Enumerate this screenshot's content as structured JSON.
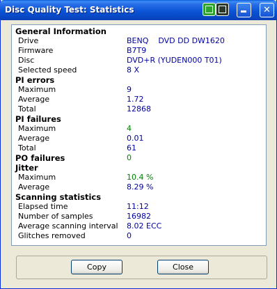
{
  "window": {
    "title": "Disc Quality Test: Statistics"
  },
  "titlebar_icons": [
    "chart-icon",
    "monitor-icon"
  ],
  "general": {
    "heading": "General Information",
    "drive_label": "Drive",
    "drive_value": "BENQ    DVD DD DW1620",
    "firmware_label": "Firmware",
    "firmware_value": "B7T9",
    "disc_label": "Disc",
    "disc_value": "DVD+R (YUDEN000 T01)",
    "speed_label": "Selected speed",
    "speed_value": "8 X"
  },
  "pi_errors": {
    "heading": "PI errors",
    "max_label": "Maximum",
    "max_value": "9",
    "avg_label": "Average",
    "avg_value": "1.72",
    "total_label": "Total",
    "total_value": "12868"
  },
  "pi_failures": {
    "heading": "PI failures",
    "max_label": "Maximum",
    "max_value": "4",
    "avg_label": "Average",
    "avg_value": "0.01",
    "total_label": "Total",
    "total_value": "61"
  },
  "po_failures": {
    "heading": "PO failures",
    "value": "0"
  },
  "jitter": {
    "heading": "Jitter",
    "max_label": "Maximum",
    "max_value": "10.4 %",
    "avg_label": "Average",
    "avg_value": "8.29 %"
  },
  "scanning": {
    "heading": "Scanning statistics",
    "elapsed_label": "Elapsed time",
    "elapsed_value": "11:12",
    "samples_label": "Number of samples",
    "samples_value": "16982",
    "interval_label": "Average scanning interval",
    "interval_value": "8.02 ECC",
    "glitches_label": "Glitches removed",
    "glitches_value": "0"
  },
  "buttons": {
    "copy_label": "Copy",
    "close_label": "Close"
  },
  "colors": {
    "title_blue": "#0a54d6",
    "value_blue": "#0000a0",
    "value_green": "#008000"
  }
}
